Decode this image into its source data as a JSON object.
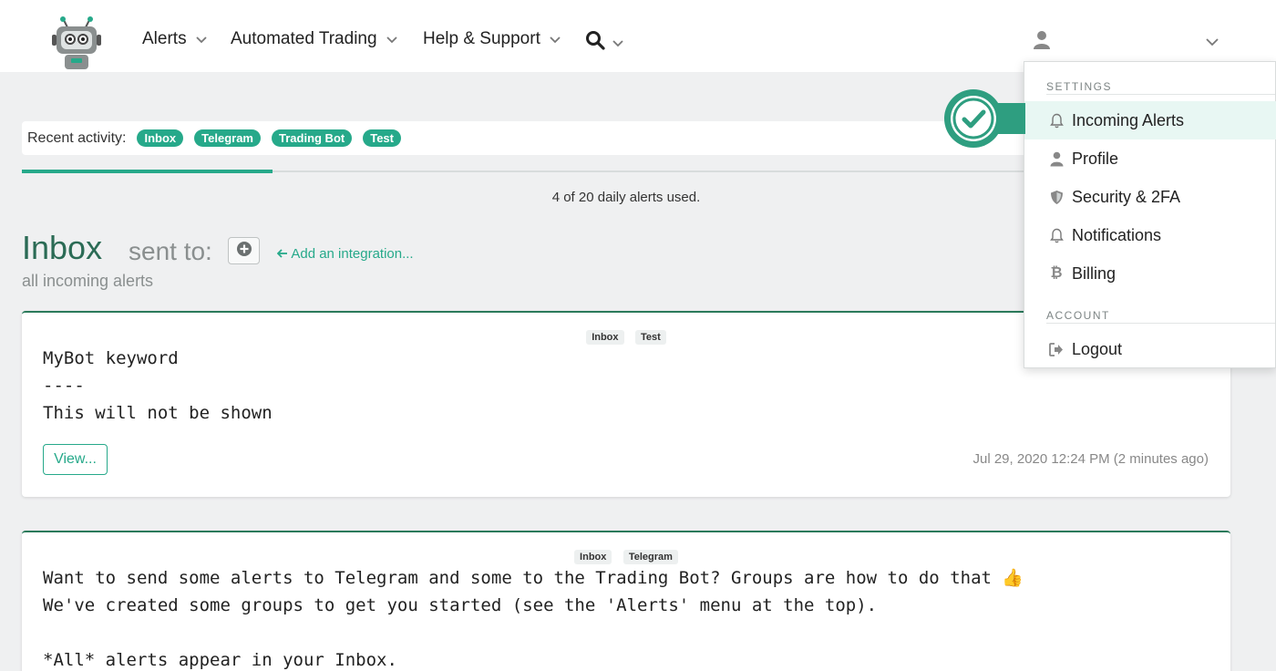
{
  "nav": {
    "items": [
      {
        "label": "Alerts"
      },
      {
        "label": "Automated Trading"
      },
      {
        "label": "Help & Support"
      }
    ]
  },
  "recent": {
    "label": "Recent activity:",
    "pills": [
      "Inbox",
      "Telegram",
      "Trading Bot",
      "Test"
    ]
  },
  "usage": {
    "text": "4 of 20 daily alerts used.",
    "used": 4,
    "limit": 20
  },
  "inbox": {
    "title": "Inbox",
    "sent_to": "sent to:",
    "add_integration": "Add an integration...",
    "subtitle": "all incoming alerts"
  },
  "cards": [
    {
      "tags": [
        "Inbox",
        "Test"
      ],
      "lines": [
        "MyBot keyword",
        "----",
        "This will not be shown"
      ],
      "view_label": "View...",
      "timestamp": "Jul 29, 2020 12:24 PM (2 minutes ago)"
    },
    {
      "tags": [
        "Inbox",
        "Telegram"
      ],
      "lines": [
        "Want to send some alerts to Telegram and some to the Trading Bot? Groups are how to do that 👍",
        "We've created some groups to get you started (see the 'Alerts' menu at the top).",
        "",
        "*All* alerts appear in your Inbox."
      ]
    }
  ],
  "dropdown": {
    "settings_header": "SETTINGS",
    "account_header": "ACCOUNT",
    "items": [
      {
        "label": "Incoming Alerts",
        "icon": "bell-icon"
      },
      {
        "label": "Profile",
        "icon": "user-icon"
      },
      {
        "label": "Security & 2FA",
        "icon": "shield-icon"
      },
      {
        "label": "Notifications",
        "icon": "bell-icon"
      },
      {
        "label": "Billing",
        "icon": "bitcoin-icon"
      }
    ],
    "logout": {
      "label": "Logout",
      "icon": "logout-icon"
    }
  },
  "colors": {
    "accent": "#26a98a",
    "title_green": "#2b6b55",
    "background": "#eff0f1"
  }
}
